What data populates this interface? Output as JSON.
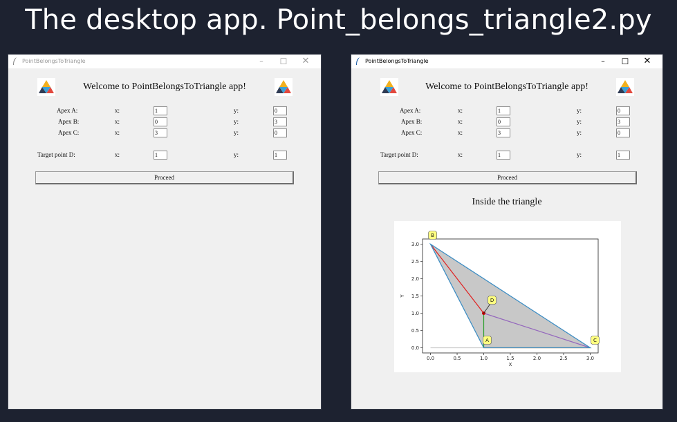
{
  "slide": {
    "title": "The desktop app. Point_belongs_triangle2.py"
  },
  "app": {
    "window_title": "PointBelongsToTriangle",
    "welcome": "Welcome to PointBelongsToTriangle app!",
    "labels": {
      "apex_a": "Apex A:",
      "apex_b": "Apex B:",
      "apex_c": "Apex C:",
      "target": "Target point D:",
      "x": "x:",
      "y": "y:"
    },
    "proceed_label": "Proceed",
    "controls": {
      "minimize": "–",
      "maximize": "☐",
      "close": "✕"
    },
    "icons": [
      "feather-icon",
      "triangle-logo-icon"
    ],
    "inputs": {
      "a_x": "1",
      "a_y": "0",
      "b_x": "0",
      "b_y": "3",
      "c_x": "3",
      "c_y": "0",
      "d_x": "1",
      "d_y": "1"
    }
  },
  "result": {
    "text": "Inside the triangle"
  },
  "chart_data": {
    "type": "scatter",
    "title": "",
    "xlabel": "X",
    "ylabel": "Y",
    "xlim": [
      -0.15,
      3.15
    ],
    "ylim": [
      -0.15,
      3.15
    ],
    "xticks": [
      "0.0",
      "0.5",
      "1.0",
      "1.5",
      "2.0",
      "2.5",
      "3.0"
    ],
    "yticks": [
      "0.0",
      "0.5",
      "1.0",
      "1.5",
      "2.0",
      "2.5",
      "3.0"
    ],
    "grid": false,
    "points": [
      {
        "label": "A",
        "x": 1,
        "y": 0
      },
      {
        "label": "B",
        "x": 0,
        "y": 3
      },
      {
        "label": "C",
        "x": 3,
        "y": 0
      },
      {
        "label": "D",
        "x": 1,
        "y": 1
      }
    ],
    "triangle": {
      "vertices": [
        [
          1,
          0
        ],
        [
          0,
          3
        ],
        [
          3,
          0
        ]
      ],
      "fill": "#c8c8c8",
      "edge": "#3e8ec4"
    },
    "segments": [
      {
        "from": [
          0,
          3
        ],
        "to": [
          1,
          1
        ],
        "color": "#e02020"
      },
      {
        "from": [
          1,
          0
        ],
        "to": [
          1,
          1
        ],
        "color": "#2ca02c"
      },
      {
        "from": [
          3,
          0
        ],
        "to": [
          1,
          1
        ],
        "color": "#9467bd"
      },
      {
        "from": [
          1,
          0
        ],
        "to": [
          3,
          0
        ],
        "color": "#ff7f0e"
      },
      {
        "from": [
          0,
          0
        ],
        "to": [
          1,
          0
        ],
        "color": "#cccccc"
      }
    ],
    "annotation_color": "#ffff80"
  }
}
